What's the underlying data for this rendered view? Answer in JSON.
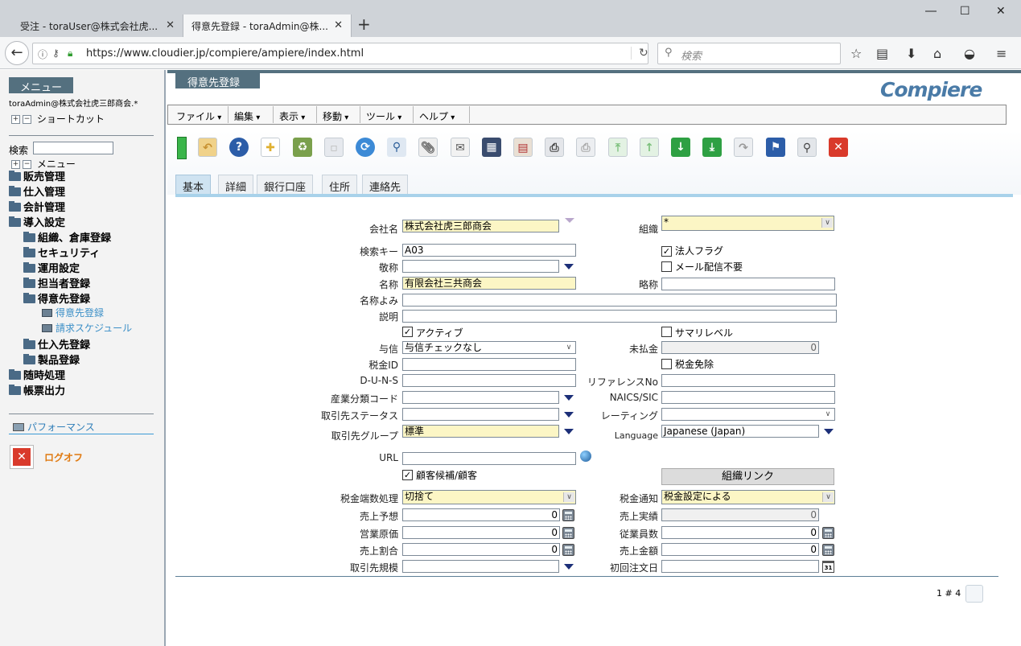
{
  "browser": {
    "tabs": [
      {
        "title": "受注 - toraUser@株式会社虎..."
      },
      {
        "title": "得意先登録 - toraAdmin@株..."
      }
    ],
    "url": "https://www.cloudier.jp/compiere/ampiere/index.html",
    "search_placeholder": "検索"
  },
  "sidebar": {
    "menu_title": "メニュー",
    "user": "toraAdmin@株式会社虎三郎商会.*",
    "shortcut_label": "ショートカット",
    "search_label": "検索",
    "menu_root_label": "メニュー",
    "tree": [
      {
        "label": "販売管理",
        "level": 0,
        "kind": "folder"
      },
      {
        "label": "仕入管理",
        "level": 0,
        "kind": "folder"
      },
      {
        "label": "会計管理",
        "level": 0,
        "kind": "folder"
      },
      {
        "label": "導入設定",
        "level": 0,
        "kind": "folder"
      },
      {
        "label": "組織、倉庫登録",
        "level": 1,
        "kind": "folder"
      },
      {
        "label": "セキュリティ",
        "level": 1,
        "kind": "folder"
      },
      {
        "label": "運用設定",
        "level": 1,
        "kind": "folder"
      },
      {
        "label": "担当者登録",
        "level": 1,
        "kind": "folder"
      },
      {
        "label": "得意先登録",
        "level": 1,
        "kind": "folder"
      },
      {
        "label": "得意先登録",
        "level": 2,
        "kind": "window"
      },
      {
        "label": "請求スケジュール",
        "level": 2,
        "kind": "window"
      },
      {
        "label": "仕入先登録",
        "level": 1,
        "kind": "folder"
      },
      {
        "label": "製品登録",
        "level": 1,
        "kind": "folder"
      },
      {
        "label": "随時処理",
        "level": 0,
        "kind": "folder"
      },
      {
        "label": "帳票出力",
        "level": 0,
        "kind": "folder"
      }
    ],
    "performance_label": "パフォーマンス",
    "logoff_label": "ログオフ"
  },
  "window": {
    "title": "得意先登録",
    "logo": "Compiere",
    "menus": [
      "ファイル",
      "編集",
      "表示",
      "移動",
      "ツール",
      "ヘルプ"
    ],
    "toolbar_icons": [
      "undo-icon",
      "help-icon",
      "new-record-icon",
      "delete-icon",
      "save-icon",
      "refresh-icon",
      "find-icon",
      "attachment-icon",
      "chat-icon",
      "grid-toggle-icon",
      "report-icon",
      "print-preview-icon",
      "print-icon",
      "first-record-icon",
      "previous-record-icon",
      "next-record-icon",
      "last-record-icon",
      "zoom-across-icon",
      "request-icon",
      "product-info-icon",
      "close-window-icon"
    ],
    "tabs": [
      "基本",
      "詳細",
      "銀行口座",
      "住所",
      "連絡先"
    ],
    "active_tab": 0
  },
  "form": {
    "company_name": {
      "label": "会社名",
      "value": "株式会社虎三郎商会"
    },
    "org": {
      "label": "組織",
      "value": "*"
    },
    "search_key": {
      "label": "検索キー",
      "value": "A03"
    },
    "legal_flag": {
      "label": "法人フラグ",
      "checked": true
    },
    "title": {
      "label": "敬称",
      "value": ""
    },
    "no_mail": {
      "label": "メール配信不要",
      "checked": false
    },
    "name": {
      "label": "名称",
      "value": "有限会社三共商会"
    },
    "short_name": {
      "label": "略称",
      "value": ""
    },
    "name_kana": {
      "label": "名称よみ",
      "value": ""
    },
    "description": {
      "label": "説明",
      "value": ""
    },
    "active": {
      "label": "アクティブ",
      "checked": true
    },
    "summary_level": {
      "label": "サマリレベル",
      "checked": false
    },
    "credit": {
      "label": "与信",
      "value": "与信チェックなし"
    },
    "open_balance": {
      "label": "未払金",
      "value": "0"
    },
    "tax_id": {
      "label": "税金ID",
      "value": ""
    },
    "tax_exempt": {
      "label": "税金免除",
      "checked": false
    },
    "duns": {
      "label": "D-U-N-S",
      "value": ""
    },
    "reference_no": {
      "label": "リファレンスNo",
      "value": ""
    },
    "industry_code": {
      "label": "産業分類コード",
      "value": ""
    },
    "naics": {
      "label": "NAICS/SIC",
      "value": ""
    },
    "bp_status": {
      "label": "取引先ステータス",
      "value": ""
    },
    "rating": {
      "label": "レーティング",
      "value": ""
    },
    "bp_group": {
      "label": "取引先グループ",
      "value": "標準"
    },
    "language": {
      "label": "Language",
      "value": "Japanese (Japan)"
    },
    "url": {
      "label": "URL",
      "value": ""
    },
    "prospect": {
      "label": "顧客候補/顧客",
      "checked": true
    },
    "org_link_button": "組織リンク",
    "tax_rounding": {
      "label": "税金端数処理",
      "value": "切捨て"
    },
    "tax_notice": {
      "label": "税金通知",
      "value": "税金設定による"
    },
    "sales_forecast": {
      "label": "売上予想",
      "value": "0"
    },
    "sales_actual": {
      "label": "売上実績",
      "value": "0"
    },
    "operating_cost": {
      "label": "営業原価",
      "value": "0"
    },
    "employees": {
      "label": "従業員数",
      "value": "0"
    },
    "sales_share": {
      "label": "売上割合",
      "value": "0"
    },
    "sales_amount": {
      "label": "売上金額",
      "value": "0"
    },
    "bp_size": {
      "label": "取引先規模",
      "value": ""
    },
    "first_order": {
      "label": "初回注文日",
      "value": ""
    },
    "calendar_glyph": "31",
    "record_counter": "1 # 4"
  },
  "colors": {
    "mandatory": "#fcf6c5",
    "header": "#54707f",
    "accent_link": "#3b8fc7",
    "logoff": "#e07a11"
  }
}
